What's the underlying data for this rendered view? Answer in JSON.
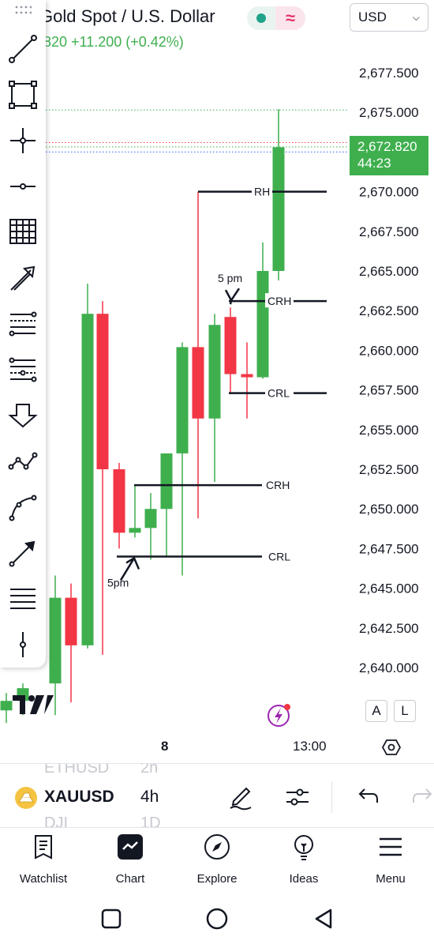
{
  "header": {
    "title": "Gold Spot / U.S. Dollar",
    "price_change": ".820  +11.200 (+0.42%)",
    "currency": "USD"
  },
  "colors": {
    "up": "#3faf4e",
    "down": "#f23645",
    "axis_text": "#131722",
    "price_badge": "#3faf4e"
  },
  "chart_data": {
    "type": "candlestick",
    "symbol": "XAUUSD",
    "timeframe": "4h",
    "y_ticks": [
      "2,677.500",
      "2,675.000",
      "2,672.500",
      "2,670.000",
      "2,667.500",
      "2,665.000",
      "2,662.500",
      "2,660.000",
      "2,657.500",
      "2,655.000",
      "2,652.500",
      "2,650.000",
      "2,647.500",
      "2,645.000",
      "2,642.500",
      "2,640.000"
    ],
    "ylim": [
      2638.5,
      2678.5
    ],
    "x_labels": [
      "8",
      "13:00"
    ],
    "candles": [
      {
        "o": 2637.3,
        "h": 2638.4,
        "l": 2636.5,
        "c": 2637.9
      },
      {
        "o": 2637.9,
        "h": 2639.0,
        "l": 2637.0,
        "c": 2638.7
      },
      {
        "o": 2639.0,
        "h": 2645.8,
        "l": 2637.0,
        "c": 2644.4
      },
      {
        "o": 2644.4,
        "h": 2645.3,
        "l": 2637.8,
        "c": 2641.4
      },
      {
        "o": 2641.4,
        "h": 2664.2,
        "l": 2641.2,
        "c": 2662.3
      },
      {
        "o": 2662.3,
        "h": 2663.1,
        "l": 2640.8,
        "c": 2652.5
      },
      {
        "o": 2652.5,
        "h": 2652.9,
        "l": 2647.5,
        "c": 2648.5
      },
      {
        "o": 2648.5,
        "h": 2651.5,
        "l": 2648.2,
        "c": 2648.8
      },
      {
        "o": 2648.8,
        "h": 2651.0,
        "l": 2646.8,
        "c": 2650.0
      },
      {
        "o": 2650.0,
        "h": 2653.5,
        "l": 2647.0,
        "c": 2653.5
      },
      {
        "o": 2653.5,
        "h": 2660.5,
        "l": 2645.8,
        "c": 2660.2
      },
      {
        "o": 2660.2,
        "h": 2670.0,
        "l": 2649.4,
        "c": 2655.7
      },
      {
        "o": 2655.7,
        "h": 2662.3,
        "l": 2651.7,
        "c": 2661.6
      },
      {
        "o": 2662.1,
        "h": 2662.7,
        "l": 2657.3,
        "c": 2658.5
      },
      {
        "o": 2658.5,
        "h": 2660.5,
        "l": 2655.7,
        "c": 2658.3
      },
      {
        "o": 2658.3,
        "h": 2666.8,
        "l": 2658.2,
        "c": 2665.0
      },
      {
        "o": 2665.0,
        "h": 2675.2,
        "l": 2664.4,
        "c": 2672.8
      }
    ],
    "current_price": "2,672.820",
    "countdown": "44:23",
    "annotations": {
      "rh": "RH",
      "crh_top": "CRH",
      "crl_top": "CRL",
      "crh_bottom": "CRH",
      "crl_bottom": "CRL",
      "five_pm_top": "5 pm",
      "five_pm_bottom": "5pm"
    },
    "legend": "none",
    "grid": false
  },
  "chart_buttons": {
    "a": "A",
    "l": "L"
  },
  "toolbar_icons": [
    "trend-line-icon",
    "rectangle-icon",
    "crosshair-icon",
    "horizontal-ray-icon",
    "grid-icon",
    "arrow-icon",
    "fib-retracement-icon",
    "fib-extension-icon",
    "arrow-down-icon",
    "polyline-icon",
    "curve-icon",
    "arrow-line-icon",
    "parallel-lines-icon",
    "vertical-line-icon"
  ],
  "symbol_bar": {
    "prev_symbol": "ETHUSD",
    "prev_tf": "2h",
    "symbol": "XAUUSD",
    "timeframe": "4h",
    "next_symbol": "DJI",
    "next_tf": "1D"
  },
  "bottom_nav": [
    {
      "label": "Watchlist",
      "icon": "list-icon"
    },
    {
      "label": "Chart",
      "icon": "chart-icon"
    },
    {
      "label": "Explore",
      "icon": "compass-icon"
    },
    {
      "label": "Ideas",
      "icon": "lightbulb-icon"
    },
    {
      "label": "Menu",
      "icon": "menu-icon"
    }
  ]
}
